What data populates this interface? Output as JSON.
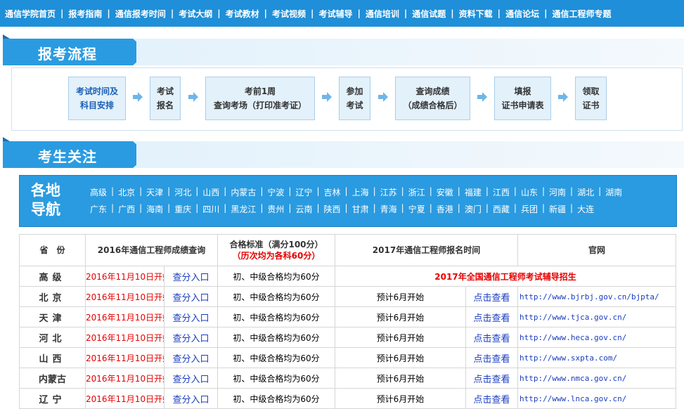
{
  "nav": [
    "通信学院首页",
    "报考指南",
    "通信报考时间",
    "考试大纲",
    "考试教材",
    "考试视频",
    "考试辅导",
    "通信培训",
    "通信试题",
    "资料下载",
    "通信论坛",
    "通信工程师专题"
  ],
  "flow": {
    "title": "报考流程",
    "steps": [
      {
        "l1": "考试时间及",
        "l2": "科目安排"
      },
      {
        "l1": "考试",
        "l2": "报名"
      },
      {
        "l1": "考前1周",
        "l2": "查询考场（打印准考证）"
      },
      {
        "l1": "参加",
        "l2": "考试"
      },
      {
        "l1": "查询成绩",
        "l2": "（成绩合格后）"
      },
      {
        "l1": "填报",
        "l2": "证书申请表"
      },
      {
        "l1": "领取",
        "l2": "证书"
      }
    ]
  },
  "concern": {
    "title": "考生关注",
    "region_title_1": "各地",
    "region_title_2": "导航",
    "row1": [
      "高级",
      "北京",
      "天津",
      "河北",
      "山西",
      "内蒙古",
      "宁波",
      "辽宁",
      "吉林",
      "上海",
      "江苏",
      "浙江",
      "安徽",
      "福建",
      "江西",
      "山东",
      "河南",
      "湖北",
      "湖南"
    ],
    "row2": [
      "广东",
      "广西",
      "海南",
      "重庆",
      "四川",
      "黑龙江",
      "贵州",
      "云南",
      "陕西",
      "甘肃",
      "青海",
      "宁夏",
      "香港",
      "澳门",
      "西藏",
      "兵团",
      "新疆",
      "大连"
    ]
  },
  "table": {
    "headers": {
      "province": "省　份",
      "query": "2016年通信工程师成绩查询",
      "standard_1": "合格标准（满分100分）",
      "standard_2": "（历次均为各科60分）",
      "signup": "2017年通信工程师报名时间",
      "site": "官网"
    },
    "query_start": "2016年11月10日开始",
    "query_link": "查分入口",
    "standard": "初、中级合格均为60分",
    "signup_time": "预计6月开始",
    "signup_link": "点击查看",
    "promo": "2017年全国通信工程师考试辅导招生",
    "rows": [
      {
        "province": "高级",
        "url": ""
      },
      {
        "province": "北京",
        "url": "http://www.bjrbj.gov.cn/bjpta/"
      },
      {
        "province": "天津",
        "url": "http://www.tjca.gov.cn/"
      },
      {
        "province": "河北",
        "url": "http://www.heca.gov.cn/"
      },
      {
        "province": "山西",
        "url": "http://www.sxpta.com/"
      },
      {
        "province": "内蒙古",
        "url": "http://www.nmca.gov.cn/"
      },
      {
        "province": "辽宁",
        "url": "http://www.lnca.gov.cn/"
      }
    ]
  }
}
